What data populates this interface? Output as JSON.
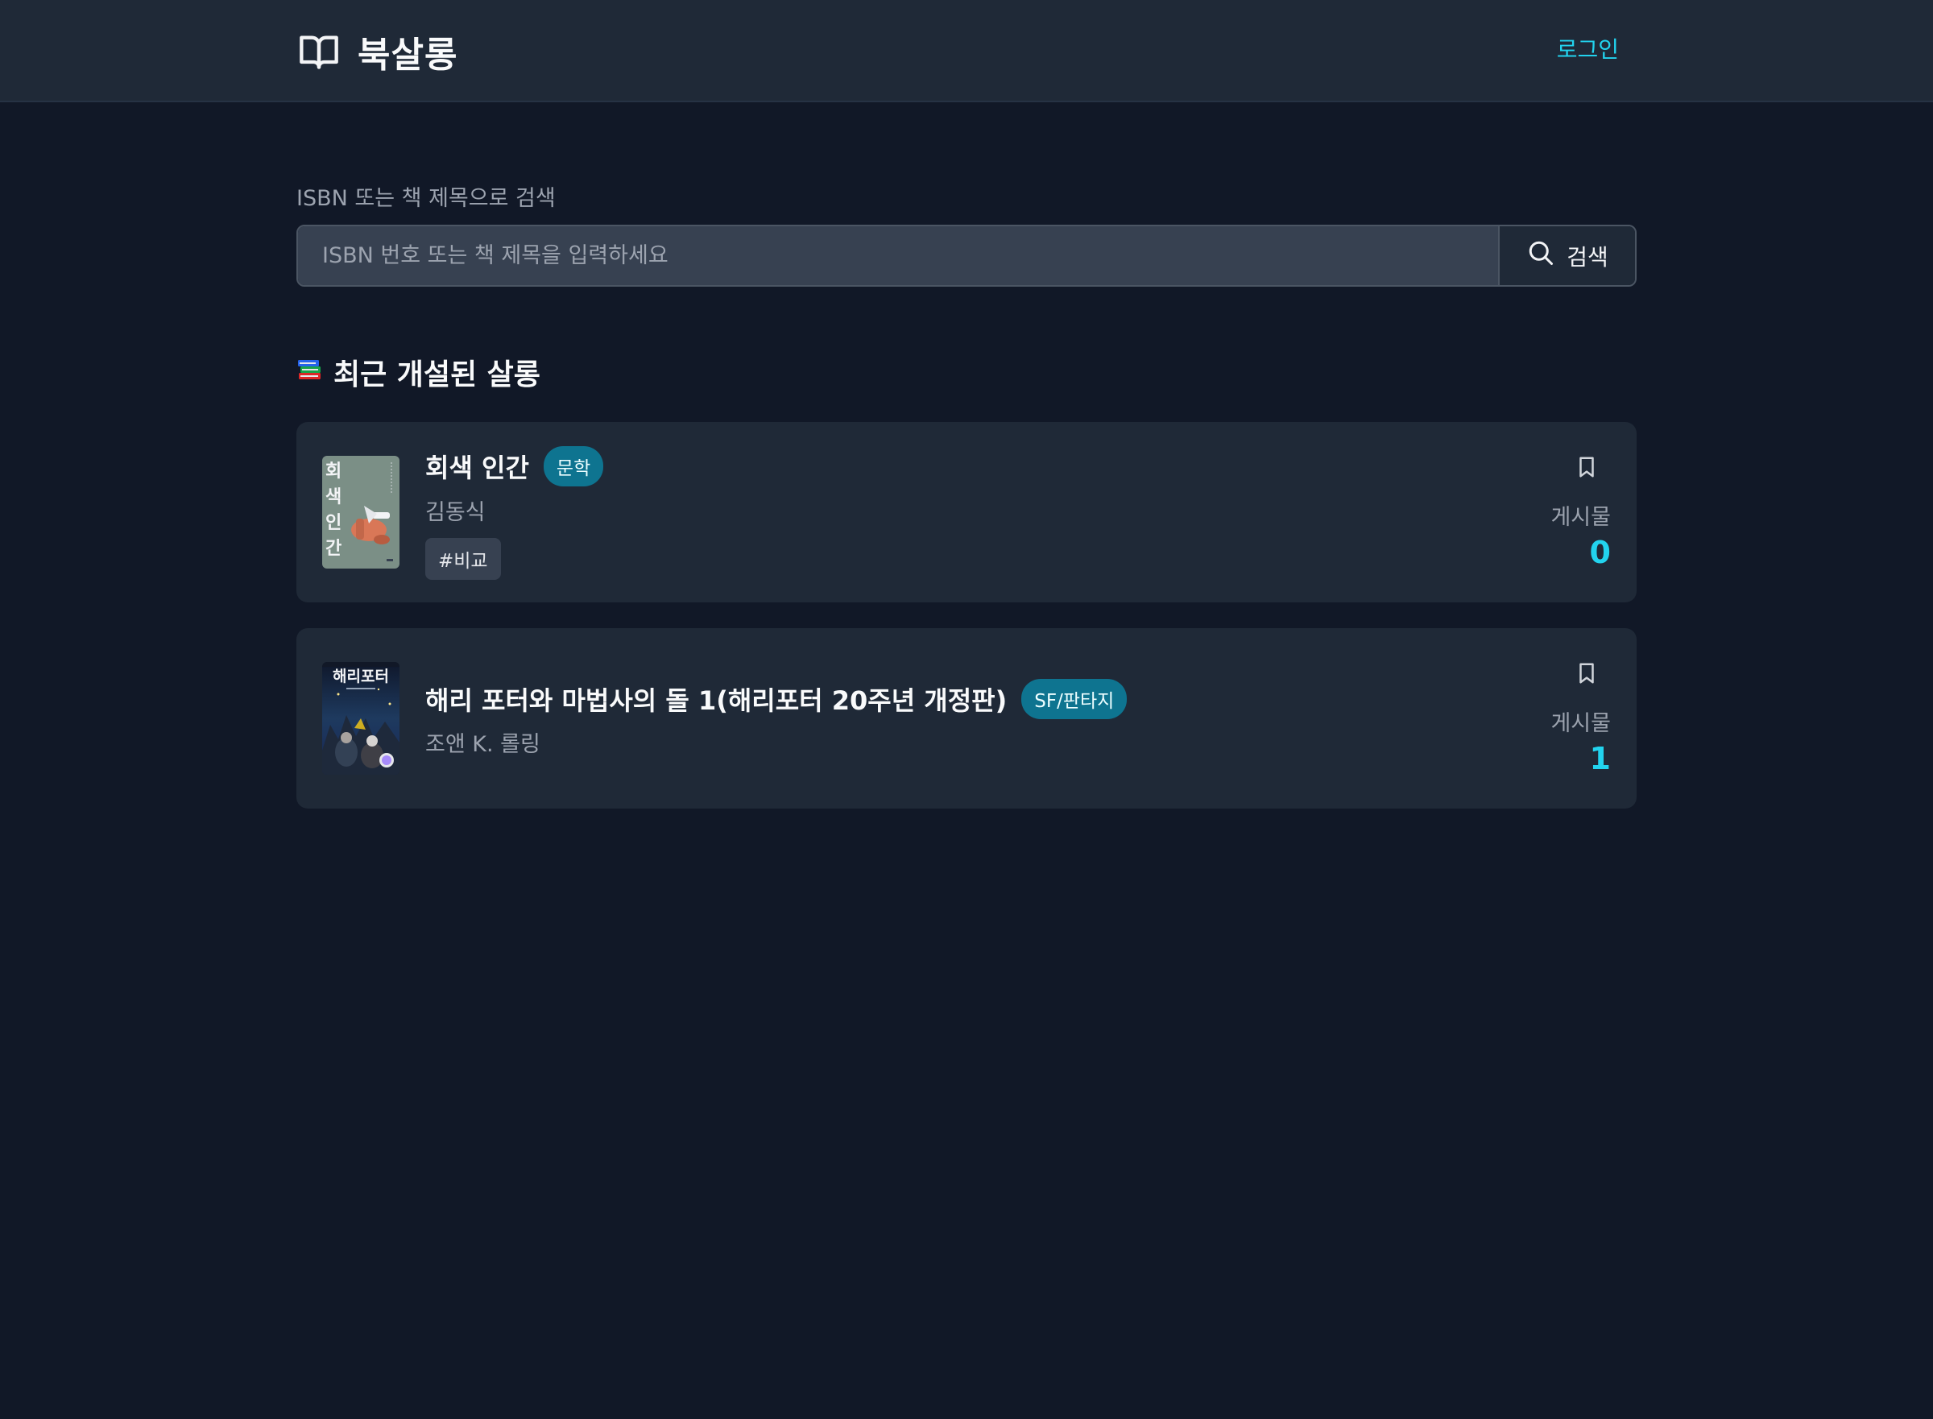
{
  "header": {
    "title": "북살롱",
    "login_label": "로그인"
  },
  "search": {
    "label": "ISBN 또는 책 제목으로 검색",
    "placeholder": "ISBN 번호 또는 책 제목을 입력하세요",
    "value": "",
    "button_label": "검색"
  },
  "section": {
    "emoji": "📚",
    "title": "최근 개설된 살롱"
  },
  "books": [
    {
      "title": "회색 인간",
      "genre": "문학",
      "author": "김동식",
      "tag": "#비교",
      "post_label": "게시물",
      "post_count": "0",
      "cover_text": [
        "회",
        "색",
        "인",
        "간"
      ]
    },
    {
      "title": "해리 포터와 마법사의 돌 1(해리포터 20주년 개정판)",
      "genre": "SF/판타지",
      "author": "조앤 K. 롤링",
      "post_label": "게시물",
      "post_count": "1",
      "cover_text": [
        "해리포터"
      ]
    }
  ],
  "colors": {
    "background": "#111827",
    "header": "#1f2937",
    "card": "#1f2937",
    "accent": "#22d3ee",
    "badge": "#0e7490"
  }
}
